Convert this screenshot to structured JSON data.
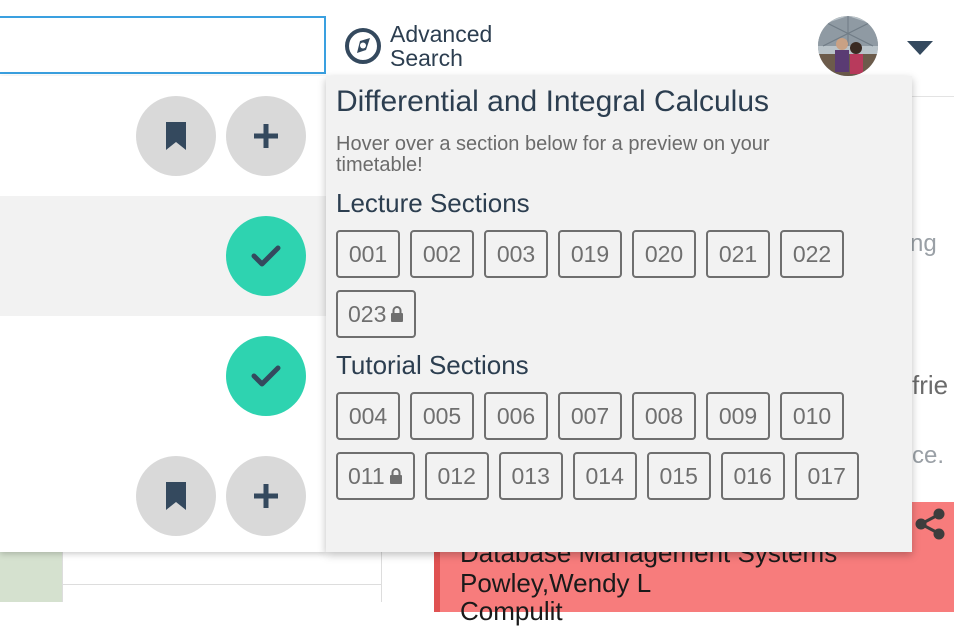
{
  "header": {
    "search_value": "",
    "advanced_search_label": "Advanced Search"
  },
  "results": {
    "rows": [
      {
        "state": "unselected",
        "actions": [
          "bookmark",
          "add"
        ]
      },
      {
        "state": "selected",
        "actions": [
          "check"
        ]
      },
      {
        "state": "selected",
        "actions": [
          "check"
        ]
      },
      {
        "state": "unselected",
        "actions": [
          "bookmark",
          "add"
        ]
      }
    ]
  },
  "popover": {
    "title": "Differential and Integral Calculus",
    "hint": "Hover over a section below for a preview on your timetable!",
    "lecture_heading": "Lecture Sections",
    "lecture_sections": [
      {
        "code": "001",
        "locked": false
      },
      {
        "code": "002",
        "locked": false
      },
      {
        "code": "003",
        "locked": false
      },
      {
        "code": "019",
        "locked": false
      },
      {
        "code": "020",
        "locked": false
      },
      {
        "code": "021",
        "locked": false
      },
      {
        "code": "022",
        "locked": false
      },
      {
        "code": "023",
        "locked": true
      }
    ],
    "tutorial_heading": "Tutorial Sections",
    "tutorial_sections": [
      {
        "code": "004",
        "locked": false
      },
      {
        "code": "005",
        "locked": false
      },
      {
        "code": "006",
        "locked": false
      },
      {
        "code": "007",
        "locked": false
      },
      {
        "code": "008",
        "locked": false
      },
      {
        "code": "009",
        "locked": false
      },
      {
        "code": "010",
        "locked": false
      },
      {
        "code": "011",
        "locked": true
      },
      {
        "code": "012",
        "locked": false
      },
      {
        "code": "013",
        "locked": false
      },
      {
        "code": "014",
        "locked": false
      },
      {
        "code": "015",
        "locked": false
      },
      {
        "code": "016",
        "locked": false
      },
      {
        "code": "017",
        "locked": false
      }
    ]
  },
  "background": {
    "partial_text_1": "ng",
    "partial_text_2": "frie",
    "partial_text_3": "ce.",
    "card_line_1": "Database Management Systems",
    "card_line_2": "Powley,Wendy L",
    "card_line_3": "Compulit"
  },
  "colors": {
    "accent_teal": "#2ed3b0",
    "search_border": "#3aa0e0",
    "card_red": "#f77c7c"
  }
}
